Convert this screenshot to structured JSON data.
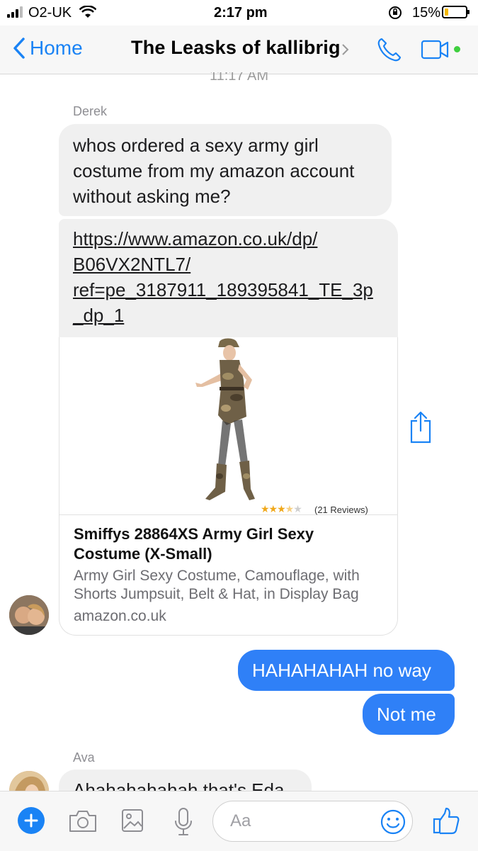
{
  "status_bar": {
    "carrier": "O2-UK",
    "time": "2:17 pm",
    "battery": "15%"
  },
  "nav": {
    "back_label": "Home",
    "title": "The Leasks of kallibrig"
  },
  "timestamp": "11:17 AM",
  "messages": {
    "derek_name": "Derek",
    "derek_text": "whos ordered a sexy army girl costume from my amazon account without asking me?",
    "link_text": "https://www.amazon.co.uk/dp/B06VX2NTL7/ref=pe_3187911_189395841_TE_3p_dp_1",
    "link_lines": [
      "https://www.amazon.co.uk/dp/",
      "B06VX2NTL7/",
      "ref=pe_3187911_189395841_TE_3p",
      "_dp_1"
    ],
    "preview": {
      "reviews": "(21 Reviews)",
      "rating": 3.5,
      "title_lines": [
        "Smiffys 28864XS Army Girl Sexy",
        "Costume (X-Small)"
      ],
      "desc_lines": [
        "Army Girl Sexy Costume, Camouflage, with",
        "Shorts Jumpsuit, Belt & Hat, in Display Bag"
      ],
      "domain": "amazon.co.uk"
    },
    "me_1": "HAHAHAHAH no way",
    "me_2": "Not me",
    "ava_name": "Ava",
    "ava_text": "Ahahahahahah that's Eda"
  },
  "composer": {
    "placeholder": "Aa"
  },
  "colors": {
    "accent": "#1a83f5",
    "bubble_blue": "#2f80f7",
    "bubble_grey": "#f0f0f0",
    "online_dot": "#3fcf3f"
  }
}
